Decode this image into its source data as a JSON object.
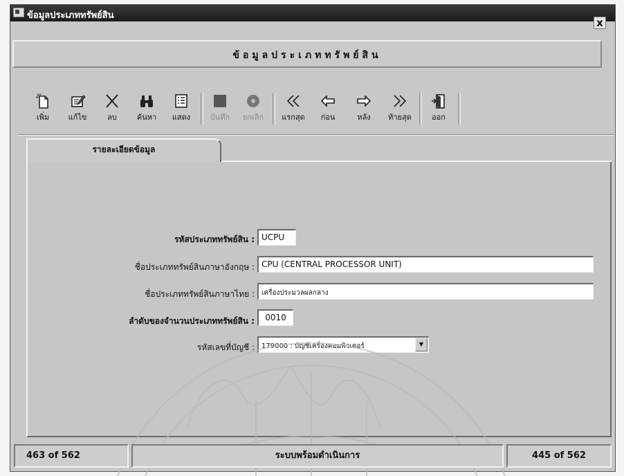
{
  "window": {
    "title": "ข้อมูลประเภททรัพย์สิน",
    "close_label": "x"
  },
  "header": {
    "title": "ข้อมูลประเภททรัพย์สิน"
  },
  "toolbar": {
    "buttons": [
      {
        "label": "เพิ่ม",
        "icon": "new-document-icon",
        "enabled": true
      },
      {
        "label": "แก้ไข",
        "icon": "edit-icon",
        "enabled": true
      },
      {
        "label": "ลบ",
        "icon": "delete-x-icon",
        "enabled": true
      },
      {
        "label": "ค้นหา",
        "icon": "binoculars-icon",
        "enabled": true
      },
      {
        "label": "แสดง",
        "icon": "list-view-icon",
        "enabled": true
      },
      {
        "label": "บันทึก",
        "icon": "save-square-icon",
        "enabled": false
      },
      {
        "label": "ยกเลิก",
        "icon": "cancel-circle-icon",
        "enabled": false
      },
      {
        "label": "แรกสุด",
        "icon": "first-arrow-icon",
        "enabled": true
      },
      {
        "label": "ก่อน",
        "icon": "previous-arrow-icon",
        "enabled": true
      },
      {
        "label": "หลัง",
        "icon": "next-arrow-icon",
        "enabled": true
      },
      {
        "label": "ท้ายสุด",
        "icon": "last-arrow-icon",
        "enabled": true
      },
      {
        "label": "ออก",
        "icon": "exit-door-icon",
        "enabled": true
      }
    ]
  },
  "tab": {
    "label": "รายละเอียดข้อมูล"
  },
  "form": {
    "code_label": "รหัสประเภททรัพย์สิน :",
    "code_value": "UCPU",
    "name_en_label": "ชื่อประเภททรัพย์สินภาษาอังกฤษ :",
    "name_en_value": "CPU (CENTRAL PROCESSOR UNIT)",
    "name_th_label": "ชื่อประเภททรัพย์สินภาษาไทย :",
    "name_th_value": "เครื่องประมวลผลกลาง",
    "seq_label": "ลำดับของจำนวนประเภททรัพย์สิน :",
    "seq_value": "0010",
    "account_label": "รหัสเลขที่บัญชี :",
    "account_value": "179000 : บัญชีเครื่องคอมพิวเตอร์"
  },
  "status": {
    "left": "463 of 562",
    "center": "ระบบพร้อมดำเนินการ",
    "right": "445 of 562"
  },
  "colors": {
    "window_bg": "#c8c8c8",
    "titlebar": "#1a1a1a",
    "field_bg": "#ffffff",
    "disabled_text": "#8a8a8a"
  }
}
